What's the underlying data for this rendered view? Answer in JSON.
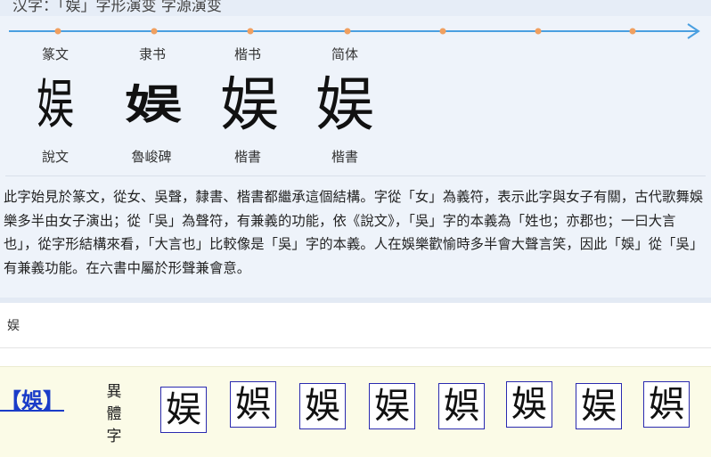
{
  "title": "汉字：「娱」字形演变 字源演变",
  "timeline": {
    "accent_color": "#4a9fe0",
    "marker_color": "#f0a060"
  },
  "eras": [
    {
      "label": "篆文",
      "glyph": "娱",
      "source": "說文"
    },
    {
      "label": "隶书",
      "glyph": "娱",
      "source": "魯峻碑"
    },
    {
      "label": "楷书",
      "glyph": "娱",
      "source": "楷書"
    },
    {
      "label": "简体",
      "glyph": "娱",
      "source": "楷書"
    }
  ],
  "paragraph": "此字始見於篆文，從女、吳聲，隸書、楷書都繼承這個結構。字從「女」為義符，表示此字與女子有關，古代歌舞娛樂多半由女子演出；從「吳」為聲符，有兼義的功能，依《說文》，「吳」字的本義為「姓也；亦郡也；一曰大言也」，從字形結構來看，「大言也」比較像是「吳」字的本義。人在娛樂歡愉時多半會大聲言笑，因此「娛」從「吳」有兼義功能。在六書中屬於形聲兼會意。",
  "search": {
    "character": "娱"
  },
  "variants": {
    "link": "【娛】",
    "type_label": [
      "異",
      "體",
      "字"
    ],
    "glyphs": [
      "娱",
      "娯",
      "娛",
      "娱",
      "娯",
      "娛",
      "娱",
      "娯"
    ],
    "link_color": "#1a3cc8",
    "box_border_color": "#2a2ab0"
  }
}
